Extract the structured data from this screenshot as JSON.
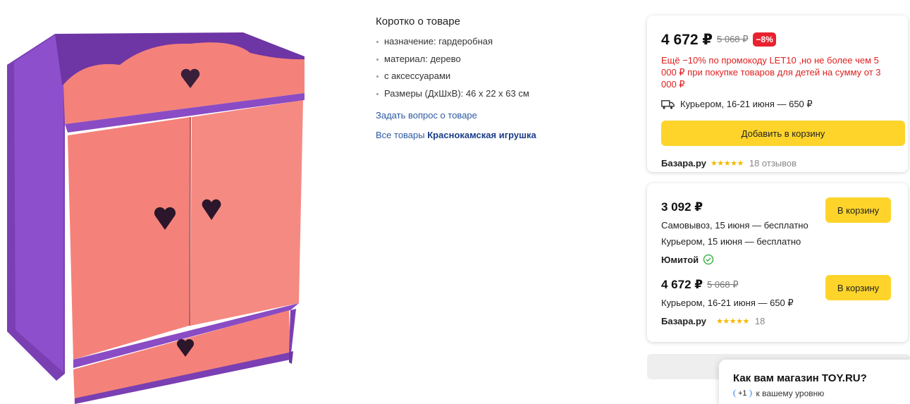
{
  "product_image": {
    "alt": "wardrobe-toy"
  },
  "specs": {
    "title": "Коротко о товаре",
    "items": [
      "назначение: гардеробная",
      "материал: дерево",
      "с аксессуарами",
      "Размеры (ДхШхВ): 46 х 22 х 63 см"
    ],
    "ask_link": "Задать вопрос о товаре",
    "all_goods_prefix": "Все товары",
    "brand": "Краснокамская игрушка"
  },
  "main_offer": {
    "price": "4 672 ₽",
    "old_price": "5 068 ₽",
    "discount": "−8%",
    "promo": "Ещё −10% по промокоду LET10 ,но не более чем 5 000 ₽ при покупке товаров для детей на сумму от 3 000 ₽",
    "delivery": "Курьером, 16-21 июня — 650 ₽",
    "add_to_cart": "Добавить в корзину",
    "shop": "Базара.ру",
    "stars": "★★★★★",
    "reviews": "18 отзывов"
  },
  "other_offers": [
    {
      "price": "3 092 ₽",
      "lines": [
        "Самовывоз, 15 июня — бесплатно",
        "Курьером, 15 июня — бесплатно"
      ],
      "button": "В корзину",
      "shop": "Юмитой"
    },
    {
      "price": "4 672 ₽",
      "old_price": "5 068 ₽",
      "lines": [
        "Курьером, 16-21 июня — 650 ₽"
      ],
      "button": "В корзину",
      "shop": "Базара.ру",
      "stars": "★★★★★",
      "reviews": "18"
    }
  ],
  "feedback_popup": {
    "title": "Как вам магазин TOY.RU?",
    "badge": "+1",
    "subtitle": "к вашему уровню"
  },
  "colors": {
    "accent_yellow": "#fed42b",
    "discount_red": "#e8222f",
    "link_blue": "#2c5aa0",
    "wardrobe_pink": "#f4827a",
    "wardrobe_purple": "#8a4cc4"
  }
}
